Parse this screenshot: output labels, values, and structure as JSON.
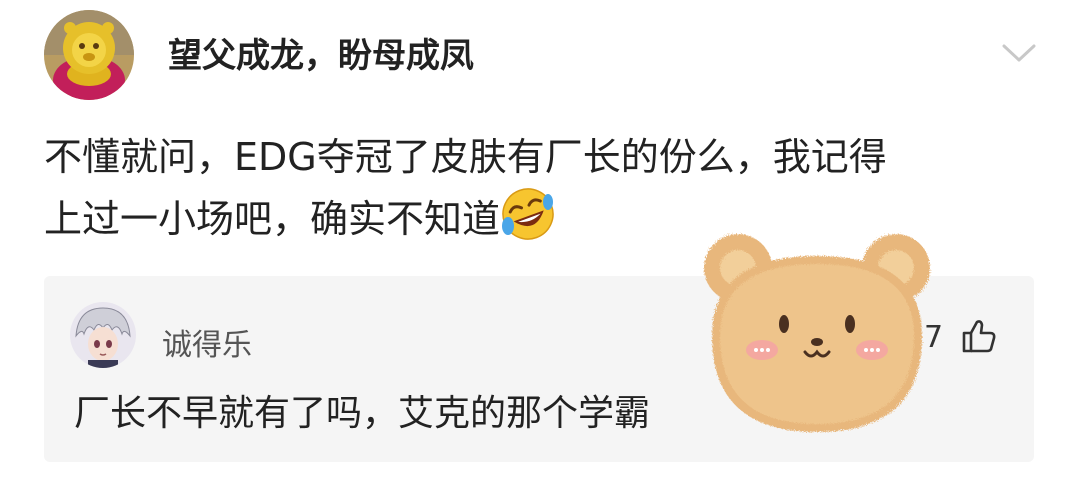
{
  "post": {
    "author": "望父成龙，盼母成凤",
    "lines": [
      "不懂就问，EDG夺冠了皮肤有厂长的份么，我记得",
      "上过一小场吧，确实不知道"
    ],
    "emoji_icon": "rofl-emoji-icon",
    "menu_icon": "chevron-down-icon"
  },
  "reply": {
    "author": "诚得乐",
    "text": "厂长不早就有了吗，艾克的那个学霸",
    "like_count": "7",
    "like_icon": "thumbs-up-icon"
  },
  "sticker": {
    "icon": "bear-face-sticker-icon"
  },
  "colors": {
    "text": "#222222",
    "reply_bg": "#f5f5f5",
    "muted": "#555555",
    "bear": "#e8b77c"
  }
}
